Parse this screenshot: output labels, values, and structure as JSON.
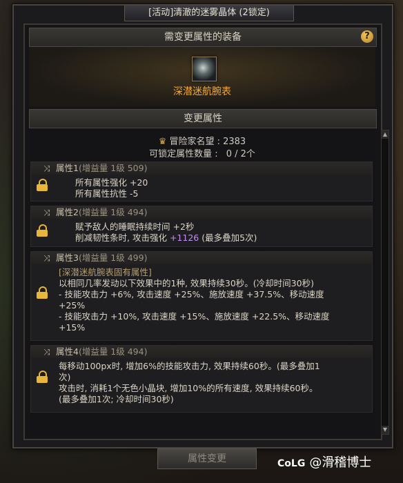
{
  "window": {
    "title": "[活动]清澈的迷雾晶体 (2锁定)"
  },
  "equip_section": {
    "header": "需变更属性的装备",
    "help_glyph": "?",
    "item_name": "深潜迷航腕表"
  },
  "change_section": {
    "header": "变更属性",
    "fame_label": "冒险家名望 : 2383",
    "lockable_label": "可锁定属性数量 :",
    "lockable_value": "0 / 2个"
  },
  "attributes": [
    {
      "title": "属性1",
      "gain": "(增益量 1级 509)",
      "lines": [
        "所有属性强化 +20",
        "所有属性抗性 -5"
      ]
    },
    {
      "title": "属性2",
      "gain": "(增益量 1级 494)",
      "lines": [
        "赋予敌人的睡眠持续时间 +2秒"
      ],
      "line2_prefix": "削减韧性条时, 攻击强化",
      "line2_value": "+1126",
      "line2_suffix": "(最多叠加5次)"
    },
    {
      "title": "属性3",
      "gain": "(增益量 1级 499)",
      "bracket_line": "[深潜迷航腕表固有属性]",
      "lines": [
        "以相同几率发动以下效果中的1种, 效果持续30秒。(冷却时间30秒)",
        "- 技能攻击力 +6%, 攻击速度 +25%、施放速度 +37.5%、移动速度",
        "+25%",
        "- 技能攻击力 +10%, 攻击速度 +15%、施放速度 +22.5%、移动速度",
        "+15%"
      ]
    },
    {
      "title": "属性4",
      "gain": "(增益量 1级 494)",
      "lines": [
        "每移动100px时, 增加6%的技能攻击力, 效果持续60秒。(最多叠加1",
        "次)",
        "攻击时, 消耗1个无色小晶块, 增加10%的所有速度, 效果持续60秒。",
        "(最多叠加1次; 冷却时间30秒)"
      ]
    }
  ],
  "footer": {
    "change_button": "属性变更"
  },
  "watermark": {
    "brand": "CoLG",
    "text": "@滑稽博士"
  },
  "colors": {
    "item_name": "#f2a93b",
    "purple_value": "#c190f2",
    "lock": "#e8b63a"
  },
  "icons": [
    "help-icon",
    "fame-icon",
    "shuffle-icon",
    "lock-icon",
    "scroll-up-icon",
    "scroll-down-icon"
  ]
}
